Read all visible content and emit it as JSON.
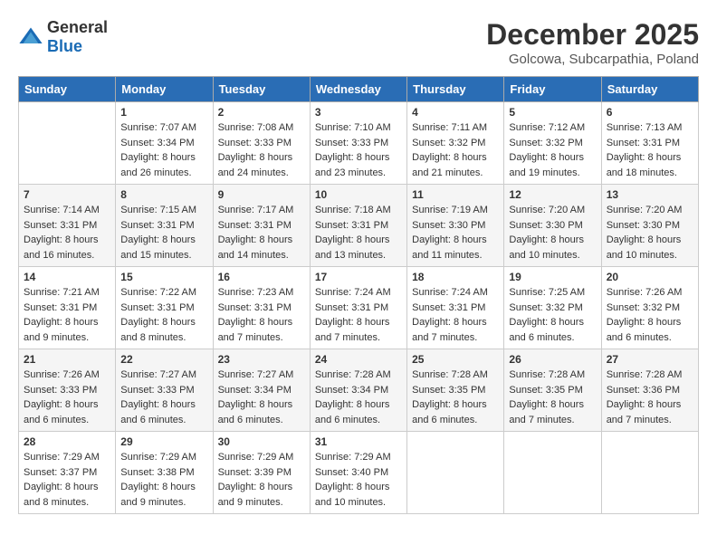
{
  "header": {
    "logo_general": "General",
    "logo_blue": "Blue",
    "month_title": "December 2025",
    "location": "Golcowa, Subcarpathia, Poland"
  },
  "days_of_week": [
    "Sunday",
    "Monday",
    "Tuesday",
    "Wednesday",
    "Thursday",
    "Friday",
    "Saturday"
  ],
  "weeks": [
    [
      {
        "day": "",
        "sunrise": "",
        "sunset": "",
        "daylight": ""
      },
      {
        "day": "1",
        "sunrise": "Sunrise: 7:07 AM",
        "sunset": "Sunset: 3:34 PM",
        "daylight": "Daylight: 8 hours and 26 minutes."
      },
      {
        "day": "2",
        "sunrise": "Sunrise: 7:08 AM",
        "sunset": "Sunset: 3:33 PM",
        "daylight": "Daylight: 8 hours and 24 minutes."
      },
      {
        "day": "3",
        "sunrise": "Sunrise: 7:10 AM",
        "sunset": "Sunset: 3:33 PM",
        "daylight": "Daylight: 8 hours and 23 minutes."
      },
      {
        "day": "4",
        "sunrise": "Sunrise: 7:11 AM",
        "sunset": "Sunset: 3:32 PM",
        "daylight": "Daylight: 8 hours and 21 minutes."
      },
      {
        "day": "5",
        "sunrise": "Sunrise: 7:12 AM",
        "sunset": "Sunset: 3:32 PM",
        "daylight": "Daylight: 8 hours and 19 minutes."
      },
      {
        "day": "6",
        "sunrise": "Sunrise: 7:13 AM",
        "sunset": "Sunset: 3:31 PM",
        "daylight": "Daylight: 8 hours and 18 minutes."
      }
    ],
    [
      {
        "day": "7",
        "sunrise": "Sunrise: 7:14 AM",
        "sunset": "Sunset: 3:31 PM",
        "daylight": "Daylight: 8 hours and 16 minutes."
      },
      {
        "day": "8",
        "sunrise": "Sunrise: 7:15 AM",
        "sunset": "Sunset: 3:31 PM",
        "daylight": "Daylight: 8 hours and 15 minutes."
      },
      {
        "day": "9",
        "sunrise": "Sunrise: 7:17 AM",
        "sunset": "Sunset: 3:31 PM",
        "daylight": "Daylight: 8 hours and 14 minutes."
      },
      {
        "day": "10",
        "sunrise": "Sunrise: 7:18 AM",
        "sunset": "Sunset: 3:31 PM",
        "daylight": "Daylight: 8 hours and 13 minutes."
      },
      {
        "day": "11",
        "sunrise": "Sunrise: 7:19 AM",
        "sunset": "Sunset: 3:30 PM",
        "daylight": "Daylight: 8 hours and 11 minutes."
      },
      {
        "day": "12",
        "sunrise": "Sunrise: 7:20 AM",
        "sunset": "Sunset: 3:30 PM",
        "daylight": "Daylight: 8 hours and 10 minutes."
      },
      {
        "day": "13",
        "sunrise": "Sunrise: 7:20 AM",
        "sunset": "Sunset: 3:30 PM",
        "daylight": "Daylight: 8 hours and 10 minutes."
      }
    ],
    [
      {
        "day": "14",
        "sunrise": "Sunrise: 7:21 AM",
        "sunset": "Sunset: 3:31 PM",
        "daylight": "Daylight: 8 hours and 9 minutes."
      },
      {
        "day": "15",
        "sunrise": "Sunrise: 7:22 AM",
        "sunset": "Sunset: 3:31 PM",
        "daylight": "Daylight: 8 hours and 8 minutes."
      },
      {
        "day": "16",
        "sunrise": "Sunrise: 7:23 AM",
        "sunset": "Sunset: 3:31 PM",
        "daylight": "Daylight: 8 hours and 7 minutes."
      },
      {
        "day": "17",
        "sunrise": "Sunrise: 7:24 AM",
        "sunset": "Sunset: 3:31 PM",
        "daylight": "Daylight: 8 hours and 7 minutes."
      },
      {
        "day": "18",
        "sunrise": "Sunrise: 7:24 AM",
        "sunset": "Sunset: 3:31 PM",
        "daylight": "Daylight: 8 hours and 7 minutes."
      },
      {
        "day": "19",
        "sunrise": "Sunrise: 7:25 AM",
        "sunset": "Sunset: 3:32 PM",
        "daylight": "Daylight: 8 hours and 6 minutes."
      },
      {
        "day": "20",
        "sunrise": "Sunrise: 7:26 AM",
        "sunset": "Sunset: 3:32 PM",
        "daylight": "Daylight: 8 hours and 6 minutes."
      }
    ],
    [
      {
        "day": "21",
        "sunrise": "Sunrise: 7:26 AM",
        "sunset": "Sunset: 3:33 PM",
        "daylight": "Daylight: 8 hours and 6 minutes."
      },
      {
        "day": "22",
        "sunrise": "Sunrise: 7:27 AM",
        "sunset": "Sunset: 3:33 PM",
        "daylight": "Daylight: 8 hours and 6 minutes."
      },
      {
        "day": "23",
        "sunrise": "Sunrise: 7:27 AM",
        "sunset": "Sunset: 3:34 PM",
        "daylight": "Daylight: 8 hours and 6 minutes."
      },
      {
        "day": "24",
        "sunrise": "Sunrise: 7:28 AM",
        "sunset": "Sunset: 3:34 PM",
        "daylight": "Daylight: 8 hours and 6 minutes."
      },
      {
        "day": "25",
        "sunrise": "Sunrise: 7:28 AM",
        "sunset": "Sunset: 3:35 PM",
        "daylight": "Daylight: 8 hours and 6 minutes."
      },
      {
        "day": "26",
        "sunrise": "Sunrise: 7:28 AM",
        "sunset": "Sunset: 3:35 PM",
        "daylight": "Daylight: 8 hours and 7 minutes."
      },
      {
        "day": "27",
        "sunrise": "Sunrise: 7:28 AM",
        "sunset": "Sunset: 3:36 PM",
        "daylight": "Daylight: 8 hours and 7 minutes."
      }
    ],
    [
      {
        "day": "28",
        "sunrise": "Sunrise: 7:29 AM",
        "sunset": "Sunset: 3:37 PM",
        "daylight": "Daylight: 8 hours and 8 minutes."
      },
      {
        "day": "29",
        "sunrise": "Sunrise: 7:29 AM",
        "sunset": "Sunset: 3:38 PM",
        "daylight": "Daylight: 8 hours and 9 minutes."
      },
      {
        "day": "30",
        "sunrise": "Sunrise: 7:29 AM",
        "sunset": "Sunset: 3:39 PM",
        "daylight": "Daylight: 8 hours and 9 minutes."
      },
      {
        "day": "31",
        "sunrise": "Sunrise: 7:29 AM",
        "sunset": "Sunset: 3:40 PM",
        "daylight": "Daylight: 8 hours and 10 minutes."
      },
      {
        "day": "",
        "sunrise": "",
        "sunset": "",
        "daylight": ""
      },
      {
        "day": "",
        "sunrise": "",
        "sunset": "",
        "daylight": ""
      },
      {
        "day": "",
        "sunrise": "",
        "sunset": "",
        "daylight": ""
      }
    ]
  ]
}
